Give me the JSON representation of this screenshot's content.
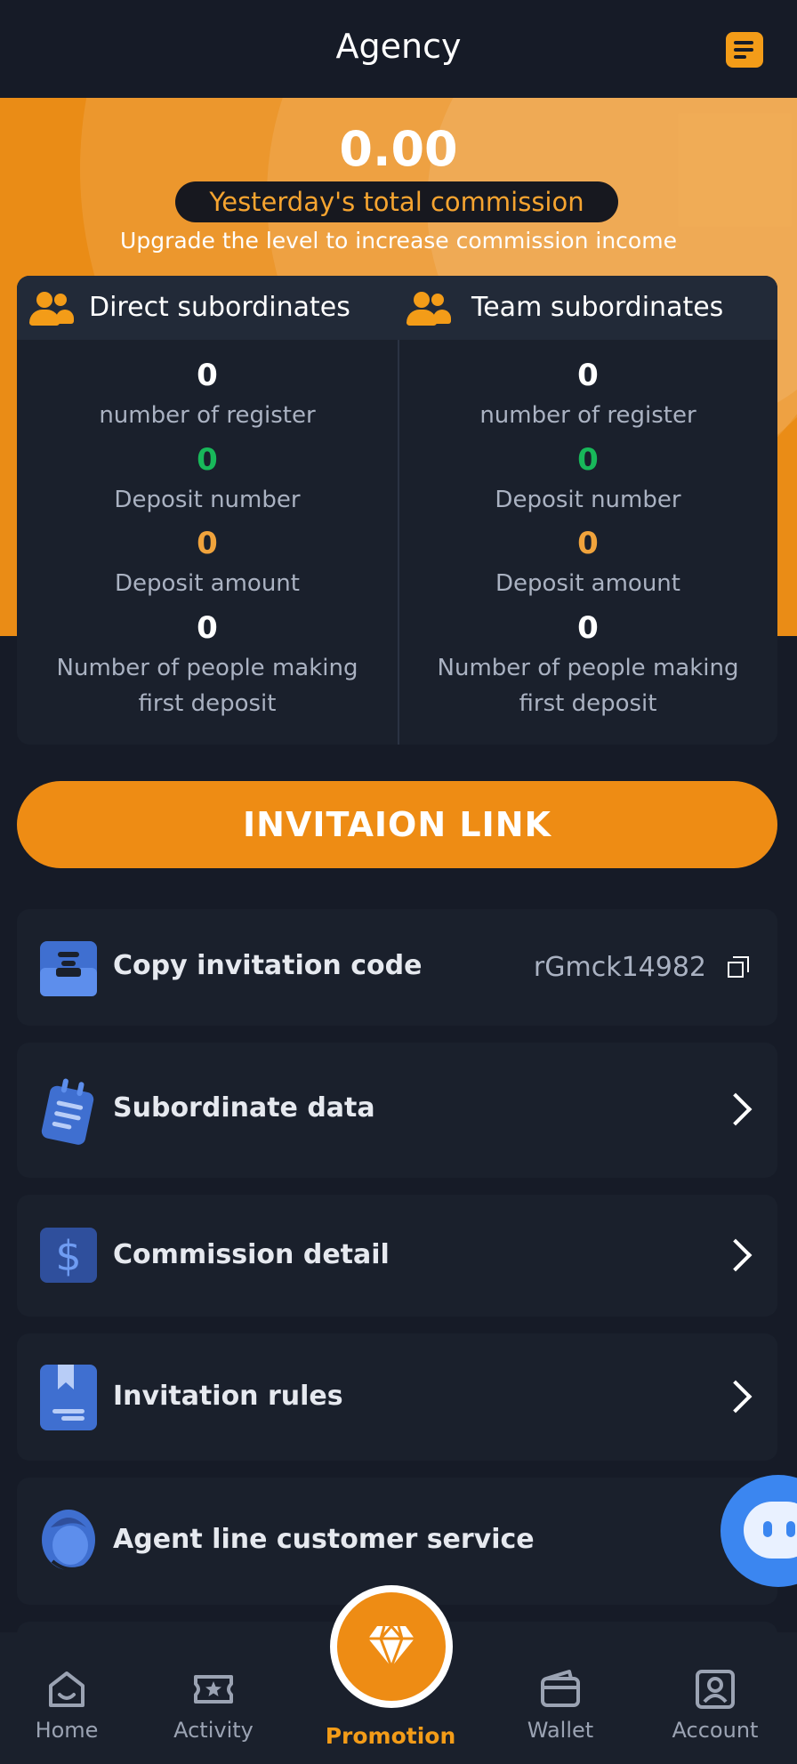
{
  "header": {
    "title": "Agency",
    "icon": "notes-icon"
  },
  "hero": {
    "amount": "0.00",
    "pill": "Yesterday's total commission",
    "subtitle": "Upgrade the level to increase commission income"
  },
  "stats": {
    "direct": {
      "title": "Direct subordinates",
      "register": {
        "value": "0",
        "label": "number of register"
      },
      "deposit_number": {
        "value": "0",
        "label": "Deposit number"
      },
      "deposit_amount": {
        "value": "0",
        "label": "Deposit amount"
      },
      "first_deposit": {
        "value": "0",
        "label_line1": "Number of people making",
        "label_line2": "first deposit"
      }
    },
    "team": {
      "title": "Team subordinates",
      "register": {
        "value": "0",
        "label": "number of register"
      },
      "deposit_number": {
        "value": "0",
        "label": "Deposit number"
      },
      "deposit_amount": {
        "value": "0",
        "label": "Deposit amount"
      },
      "first_deposit": {
        "value": "0",
        "label_line1": "Number of people making",
        "label_line2": "first deposit"
      }
    }
  },
  "invite_button": "INVITAION LINK",
  "menu": {
    "copy_code": {
      "label": "Copy invitation code",
      "code": "rGmck14982"
    },
    "subordinate_data": {
      "label": "Subordinate data"
    },
    "commission_detail": {
      "label": "Commission detail",
      "icon_glyph": "$"
    },
    "invitation_rules": {
      "label": "Invitation rules"
    },
    "agent_service": {
      "label": "Agent line customer service"
    }
  },
  "tabbar": {
    "home": "Home",
    "activity": "Activity",
    "promotion": "Promotion",
    "wallet": "Wallet",
    "account": "Account"
  },
  "colors": {
    "accent": "#ee8c14",
    "background": "#161b27",
    "card": "#1a202c",
    "green": "#18b85a"
  }
}
